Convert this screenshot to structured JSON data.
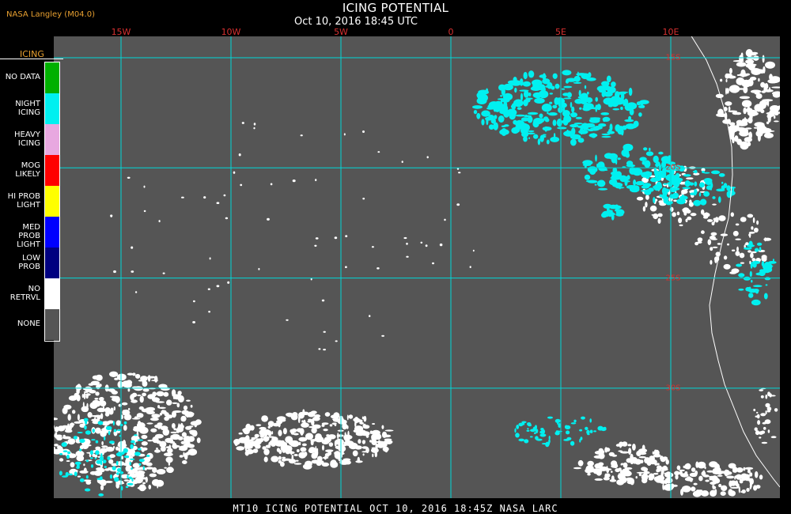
{
  "header": {
    "source": "NASA Langley (M04.0)",
    "title": "ICING POTENTIAL",
    "subtitle": "Oct 10, 2016 18:45 UTC"
  },
  "longitudes": [
    {
      "label": "15W",
      "value": -15
    },
    {
      "label": "10W",
      "value": -10
    },
    {
      "label": "5W",
      "value": -5
    },
    {
      "label": "0",
      "value": 0
    },
    {
      "label": "5E",
      "value": 5
    },
    {
      "label": "10E",
      "value": 10
    }
  ],
  "latitudes": [
    {
      "label": "15S",
      "value": -15
    },
    {
      "label": "20S",
      "value": -20
    },
    {
      "label": "25S",
      "value": -25
    },
    {
      "label": "30S",
      "value": -30
    }
  ],
  "legend": {
    "title": "ICING",
    "items": [
      {
        "line1": "NO DATA",
        "line2": "",
        "color": "#00b000"
      },
      {
        "line1": "NIGHT",
        "line2": "ICING",
        "color": "#00f0f0"
      },
      {
        "line1": "HEAVY",
        "line2": "ICING",
        "color": "#e8a8e0"
      },
      {
        "line1": "MOG",
        "line2": "LIKELY",
        "color": "#ff0000"
      },
      {
        "line1": "HI PROB",
        "line2": "LIGHT",
        "color": "#ffff00"
      },
      {
        "line1": "MED PROB",
        "line2": "LIGHT",
        "color": "#0000ff"
      },
      {
        "line1": "LOW",
        "line2": "PROB",
        "color": "#000080"
      },
      {
        "line1": "NO",
        "line2": "RETRVL",
        "color": "#ffffff"
      },
      {
        "line1": "NONE",
        "line2": "",
        "color": "#555555"
      }
    ]
  },
  "colors": {
    "background": "#555555",
    "grid": "#00d8d8",
    "label": "#d83030",
    "night_icing": "#00f0f0",
    "no_retrieval": "#ffffff"
  },
  "footer": {
    "caption": "MT10  ICING POTENTIAL   OCT 10, 2016 18:45Z   NASA LARC"
  }
}
